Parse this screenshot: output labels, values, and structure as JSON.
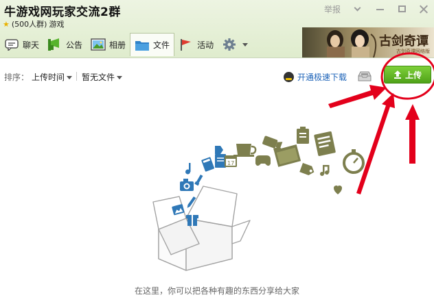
{
  "window": {
    "title": "牛游戏网玩家交流2群",
    "subtitle_count": "(500人群)",
    "subtitle_tag": "游戏",
    "report_label": "举报"
  },
  "ad": {
    "brand": "古剑奇谭",
    "tagline": "古剑奇谭网络版"
  },
  "tabs": [
    {
      "label": "聊天",
      "icon": "chat-icon"
    },
    {
      "label": "公告",
      "icon": "megaphone-icon"
    },
    {
      "label": "相册",
      "icon": "photo-album-icon"
    },
    {
      "label": "文件",
      "icon": "folder-icon",
      "active": true
    },
    {
      "label": "活动",
      "icon": "flag-icon"
    }
  ],
  "toolbar": {
    "sort_label": "排序：",
    "sort_value": "上传时间",
    "no_file_label": "暂无文件",
    "fast_download_label": "开通极速下载",
    "upload_label": "上传"
  },
  "empty_state": {
    "message": "在这里，你可以把各种有趣的东西分享给大家"
  },
  "colors": {
    "accent_green": "#5cb626",
    "link_blue": "#1d63b8",
    "illustration_blue": "#2f78b7",
    "illustration_olive": "#7d7f4e",
    "annotation_red": "#e3001b"
  }
}
